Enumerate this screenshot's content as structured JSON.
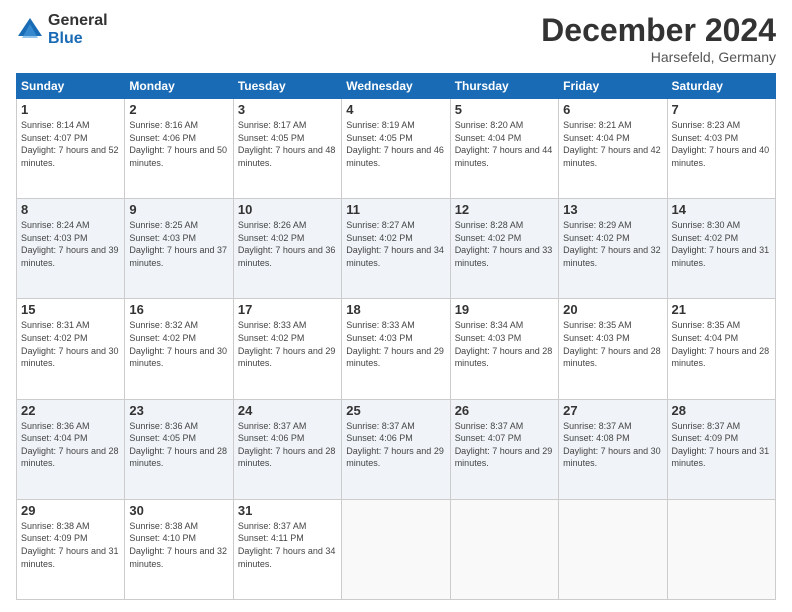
{
  "logo": {
    "general": "General",
    "blue": "Blue"
  },
  "header": {
    "month": "December 2024",
    "location": "Harsefeld, Germany"
  },
  "weekdays": [
    "Sunday",
    "Monday",
    "Tuesday",
    "Wednesday",
    "Thursday",
    "Friday",
    "Saturday"
  ],
  "weeks": [
    [
      {
        "day": "1",
        "sunrise": "8:14 AM",
        "sunset": "4:07 PM",
        "daylight": "7 hours and 52 minutes."
      },
      {
        "day": "2",
        "sunrise": "8:16 AM",
        "sunset": "4:06 PM",
        "daylight": "7 hours and 50 minutes."
      },
      {
        "day": "3",
        "sunrise": "8:17 AM",
        "sunset": "4:05 PM",
        "daylight": "7 hours and 48 minutes."
      },
      {
        "day": "4",
        "sunrise": "8:19 AM",
        "sunset": "4:05 PM",
        "daylight": "7 hours and 46 minutes."
      },
      {
        "day": "5",
        "sunrise": "8:20 AM",
        "sunset": "4:04 PM",
        "daylight": "7 hours and 44 minutes."
      },
      {
        "day": "6",
        "sunrise": "8:21 AM",
        "sunset": "4:04 PM",
        "daylight": "7 hours and 42 minutes."
      },
      {
        "day": "7",
        "sunrise": "8:23 AM",
        "sunset": "4:03 PM",
        "daylight": "7 hours and 40 minutes."
      }
    ],
    [
      {
        "day": "8",
        "sunrise": "8:24 AM",
        "sunset": "4:03 PM",
        "daylight": "7 hours and 39 minutes."
      },
      {
        "day": "9",
        "sunrise": "8:25 AM",
        "sunset": "4:03 PM",
        "daylight": "7 hours and 37 minutes."
      },
      {
        "day": "10",
        "sunrise": "8:26 AM",
        "sunset": "4:02 PM",
        "daylight": "7 hours and 36 minutes."
      },
      {
        "day": "11",
        "sunrise": "8:27 AM",
        "sunset": "4:02 PM",
        "daylight": "7 hours and 34 minutes."
      },
      {
        "day": "12",
        "sunrise": "8:28 AM",
        "sunset": "4:02 PM",
        "daylight": "7 hours and 33 minutes."
      },
      {
        "day": "13",
        "sunrise": "8:29 AM",
        "sunset": "4:02 PM",
        "daylight": "7 hours and 32 minutes."
      },
      {
        "day": "14",
        "sunrise": "8:30 AM",
        "sunset": "4:02 PM",
        "daylight": "7 hours and 31 minutes."
      }
    ],
    [
      {
        "day": "15",
        "sunrise": "8:31 AM",
        "sunset": "4:02 PM",
        "daylight": "7 hours and 30 minutes."
      },
      {
        "day": "16",
        "sunrise": "8:32 AM",
        "sunset": "4:02 PM",
        "daylight": "7 hours and 30 minutes."
      },
      {
        "day": "17",
        "sunrise": "8:33 AM",
        "sunset": "4:02 PM",
        "daylight": "7 hours and 29 minutes."
      },
      {
        "day": "18",
        "sunrise": "8:33 AM",
        "sunset": "4:03 PM",
        "daylight": "7 hours and 29 minutes."
      },
      {
        "day": "19",
        "sunrise": "8:34 AM",
        "sunset": "4:03 PM",
        "daylight": "7 hours and 28 minutes."
      },
      {
        "day": "20",
        "sunrise": "8:35 AM",
        "sunset": "4:03 PM",
        "daylight": "7 hours and 28 minutes."
      },
      {
        "day": "21",
        "sunrise": "8:35 AM",
        "sunset": "4:04 PM",
        "daylight": "7 hours and 28 minutes."
      }
    ],
    [
      {
        "day": "22",
        "sunrise": "8:36 AM",
        "sunset": "4:04 PM",
        "daylight": "7 hours and 28 minutes."
      },
      {
        "day": "23",
        "sunrise": "8:36 AM",
        "sunset": "4:05 PM",
        "daylight": "7 hours and 28 minutes."
      },
      {
        "day": "24",
        "sunrise": "8:37 AM",
        "sunset": "4:06 PM",
        "daylight": "7 hours and 28 minutes."
      },
      {
        "day": "25",
        "sunrise": "8:37 AM",
        "sunset": "4:06 PM",
        "daylight": "7 hours and 29 minutes."
      },
      {
        "day": "26",
        "sunrise": "8:37 AM",
        "sunset": "4:07 PM",
        "daylight": "7 hours and 29 minutes."
      },
      {
        "day": "27",
        "sunrise": "8:37 AM",
        "sunset": "4:08 PM",
        "daylight": "7 hours and 30 minutes."
      },
      {
        "day": "28",
        "sunrise": "8:37 AM",
        "sunset": "4:09 PM",
        "daylight": "7 hours and 31 minutes."
      }
    ],
    [
      {
        "day": "29",
        "sunrise": "8:38 AM",
        "sunset": "4:09 PM",
        "daylight": "7 hours and 31 minutes."
      },
      {
        "day": "30",
        "sunrise": "8:38 AM",
        "sunset": "4:10 PM",
        "daylight": "7 hours and 32 minutes."
      },
      {
        "day": "31",
        "sunrise": "8:37 AM",
        "sunset": "4:11 PM",
        "daylight": "7 hours and 34 minutes."
      },
      null,
      null,
      null,
      null
    ]
  ]
}
